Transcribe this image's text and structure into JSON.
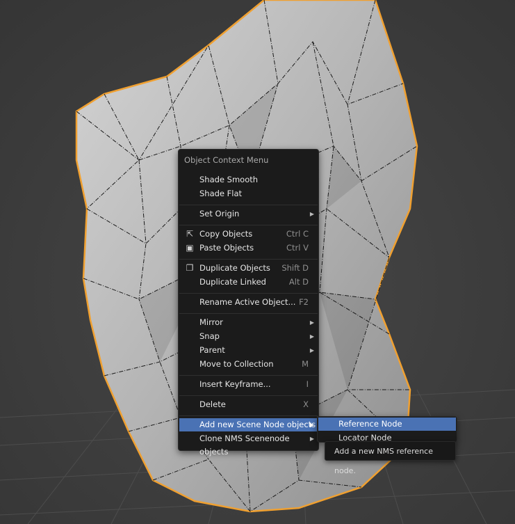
{
  "context_menu": {
    "title": "Object Context Menu",
    "items": [
      {
        "label": "Shade Smooth"
      },
      {
        "label": "Shade Flat"
      },
      {
        "label": "Set Origin"
      },
      {
        "label": "Copy Objects",
        "shortcut": "Ctrl C",
        "icon": "copy-icon"
      },
      {
        "label": "Paste Objects",
        "shortcut": "Ctrl V",
        "icon": "paste-icon"
      },
      {
        "label": "Duplicate Objects",
        "shortcut": "Shift D",
        "icon": "duplicate-icon"
      },
      {
        "label": "Duplicate Linked",
        "shortcut": "Alt D"
      },
      {
        "label": "Rename Active Object...",
        "shortcut": "F2"
      },
      {
        "label": "Mirror"
      },
      {
        "label": "Snap"
      },
      {
        "label": "Parent"
      },
      {
        "label": "Move to Collection",
        "shortcut": "M"
      },
      {
        "label": "Insert Keyframe...",
        "shortcut": "I"
      },
      {
        "label": "Delete",
        "shortcut": "X"
      },
      {
        "label": "Add new Scene Node objects"
      },
      {
        "label": "Clone NMS Scenenode objects"
      }
    ]
  },
  "submenu": {
    "items": [
      {
        "label": "Reference Node"
      },
      {
        "label": "Locator Node"
      }
    ]
  },
  "tooltip": {
    "text": "Add a new NMS reference node."
  },
  "colors": {
    "highlight": "#4a72b4",
    "selection_outline": "#f0a030",
    "menu_bg": "#1b1b1b"
  }
}
